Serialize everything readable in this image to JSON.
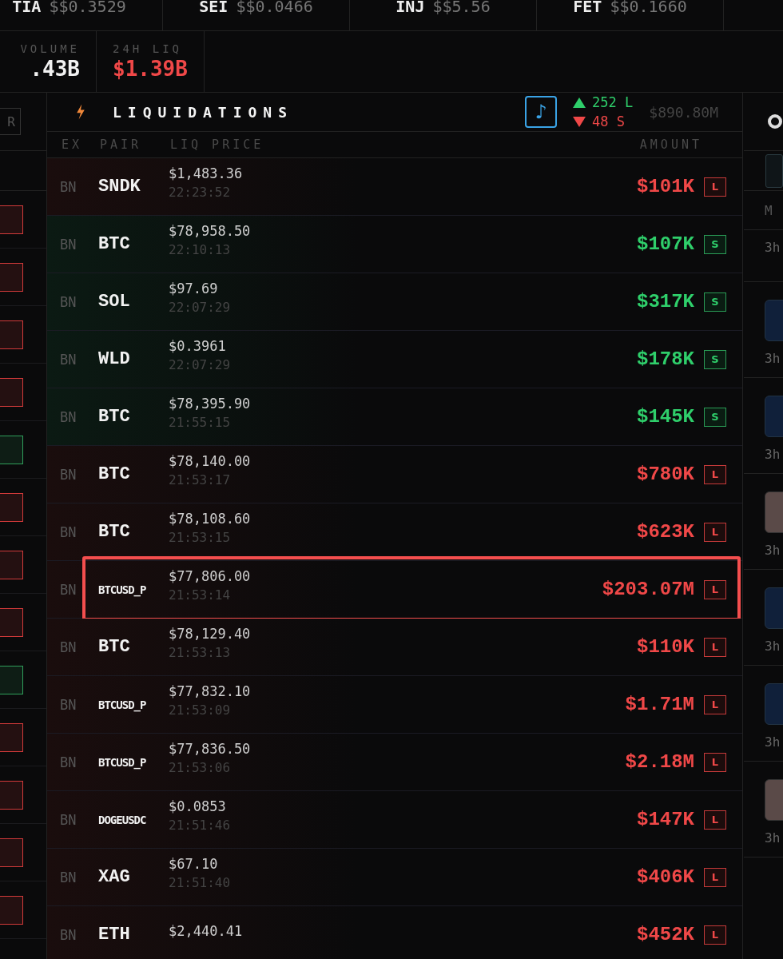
{
  "ticker": [
    {
      "symbol": "TIA",
      "price": "$$0.3529"
    },
    {
      "symbol": "SEI",
      "price": "$$0.0466"
    },
    {
      "symbol": "INJ",
      "price": "$$5.56"
    },
    {
      "symbol": "FET",
      "price": "$$0.1660"
    }
  ],
  "stats": [
    {
      "label": "VOLUME",
      "value": ".43B",
      "color": "#f1f1f1"
    },
    {
      "label": "24H LIQ",
      "value": "$1.39B",
      "color": "#f04848"
    }
  ],
  "left_column": {
    "button": "R",
    "badges": [
      {
        "color": "#d23a3a"
      },
      {
        "color": "#d23a3a"
      },
      {
        "color": "#d23a3a"
      },
      {
        "color": "#d23a3a"
      },
      {
        "color": "#2f9e5a"
      },
      {
        "color": "#d23a3a"
      },
      {
        "color": "#d23a3a"
      },
      {
        "color": "#d23a3a"
      },
      {
        "color": "#2f9e5a"
      },
      {
        "color": "#d23a3a"
      },
      {
        "color": "#d23a3a"
      },
      {
        "color": "#d23a3a"
      },
      {
        "color": "#d23a3a"
      }
    ]
  },
  "panel": {
    "title": "LIQUIDATIONS",
    "sound_icon": "♪",
    "long_count": "252 L",
    "short_count": "48 S",
    "total": "$890.80M",
    "columns": [
      "EX",
      "PAIR",
      "LIQ PRICE",
      "AMOUNT"
    ],
    "rows": [
      {
        "ex": "BN",
        "pair": "SNDK",
        "compact": false,
        "price": "$1,483.36",
        "time": "22:23:52",
        "amount": "$101K",
        "side": "L",
        "highlighted": false
      },
      {
        "ex": "BN",
        "pair": "BTC",
        "compact": false,
        "price": "$78,958.50",
        "time": "22:10:13",
        "amount": "$107K",
        "side": "S",
        "highlighted": false
      },
      {
        "ex": "BN",
        "pair": "SOL",
        "compact": false,
        "price": "$97.69",
        "time": "22:07:29",
        "amount": "$317K",
        "side": "S",
        "highlighted": false
      },
      {
        "ex": "BN",
        "pair": "WLD",
        "compact": false,
        "price": "$0.3961",
        "time": "22:07:29",
        "amount": "$178K",
        "side": "S",
        "highlighted": false
      },
      {
        "ex": "BN",
        "pair": "BTC",
        "compact": false,
        "price": "$78,395.90",
        "time": "21:55:15",
        "amount": "$145K",
        "side": "S",
        "highlighted": false
      },
      {
        "ex": "BN",
        "pair": "BTC",
        "compact": false,
        "price": "$78,140.00",
        "time": "21:53:17",
        "amount": "$780K",
        "side": "L",
        "highlighted": false
      },
      {
        "ex": "BN",
        "pair": "BTC",
        "compact": false,
        "price": "$78,108.60",
        "time": "21:53:15",
        "amount": "$623K",
        "side": "L",
        "highlighted": false
      },
      {
        "ex": "BN",
        "pair": "BTCUSD_P",
        "compact": true,
        "price": "$77,806.00",
        "time": "21:53:14",
        "amount": "$203.07M",
        "side": "L",
        "highlighted": true
      },
      {
        "ex": "BN",
        "pair": "BTC",
        "compact": false,
        "price": "$78,129.40",
        "time": "21:53:13",
        "amount": "$110K",
        "side": "L",
        "highlighted": false
      },
      {
        "ex": "BN",
        "pair": "BTCUSD_P",
        "compact": true,
        "price": "$77,832.10",
        "time": "21:53:09",
        "amount": "$1.71M",
        "side": "L",
        "highlighted": false
      },
      {
        "ex": "BN",
        "pair": "BTCUSD_P",
        "compact": true,
        "price": "$77,836.50",
        "time": "21:53:06",
        "amount": "$2.18M",
        "side": "L",
        "highlighted": false
      },
      {
        "ex": "BN",
        "pair": "DOGEUSDC",
        "compact": true,
        "price": "$0.0853",
        "time": "21:51:46",
        "amount": "$147K",
        "side": "L",
        "highlighted": false
      },
      {
        "ex": "BN",
        "pair": "XAG",
        "compact": false,
        "price": "$67.10",
        "time": "21:51:40",
        "amount": "$406K",
        "side": "L",
        "highlighted": false
      },
      {
        "ex": "BN",
        "pair": "ETH",
        "compact": false,
        "price": "$2,440.41",
        "amount": "$452K",
        "side": "L",
        "highlighted": false
      }
    ]
  },
  "right_column": {
    "header": "M",
    "items": [
      {
        "kind": "text",
        "time": "3h"
      },
      {
        "kind": "thumb",
        "time": "3h"
      },
      {
        "kind": "thumb",
        "time": "3h"
      },
      {
        "kind": "photo",
        "time": "3h"
      },
      {
        "kind": "thumb",
        "time": "3h"
      },
      {
        "kind": "thumb",
        "time": "3h"
      },
      {
        "kind": "photo",
        "time": "3h"
      }
    ]
  }
}
